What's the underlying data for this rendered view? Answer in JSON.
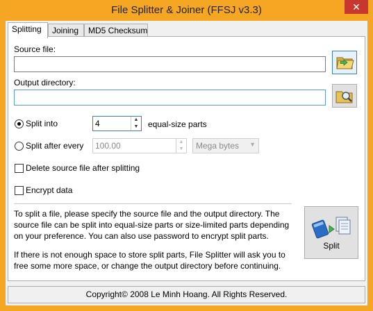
{
  "window": {
    "title": "File Splitter & Joiner (FFSJ v3.3)",
    "close_glyph": "✕"
  },
  "tabs": [
    {
      "label": "Splitting",
      "active": true
    },
    {
      "label": "Joining",
      "active": false
    },
    {
      "label": "MD5 Checksum",
      "active": false
    }
  ],
  "splitting": {
    "source_file_label": "Source file:",
    "source_file_value": "",
    "output_dir_label": "Output directory:",
    "output_dir_value": "",
    "split_into_label": "Split into",
    "split_into_value": "4",
    "equal_parts_label": "equal-size parts",
    "split_after_label": "Split after every",
    "split_after_value": "100.00",
    "unit_value": "Mega bytes",
    "delete_source_label": "Delete source file after splitting",
    "encrypt_label": "Encrypt data",
    "info_text_1": "To split a file, please specify the source file and the output directory. The source file can be split into equal-size parts or size-limited parts depending on your preference. You can also use password to encrypt split parts.",
    "info_text_2": "If there is not enough space to store split parts, File Splitter will ask you to free some more space, or change the output directory before continuing.",
    "split_button_label": "Split"
  },
  "status_bar": {
    "text": "Copyright© 2008 Le Minh Hoang. All Rights Reserved."
  },
  "colors": {
    "titlebar": "#f5a623",
    "close": "#c7372f",
    "focus_border": "#5a9bd5"
  }
}
